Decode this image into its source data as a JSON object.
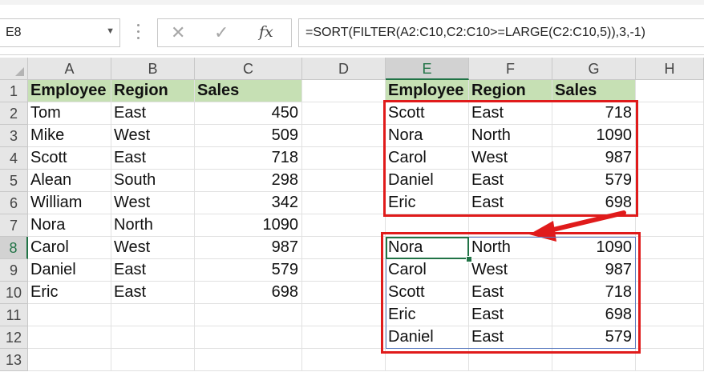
{
  "formula_bar": {
    "name_box": "E8",
    "cancel_icon": "✕",
    "enter_icon": "✓",
    "fx_label": "fx",
    "formula": "=SORT(FILTER(A2:C10,C2:C10>=LARGE(C2:C10,5)),3,-1)"
  },
  "columns": [
    "A",
    "B",
    "C",
    "D",
    "E",
    "F",
    "G",
    "H"
  ],
  "selected_column": "E",
  "rows": [
    "1",
    "2",
    "3",
    "4",
    "5",
    "6",
    "7",
    "8",
    "9",
    "10",
    "11",
    "12",
    "13"
  ],
  "selected_row": "8",
  "source_table": {
    "headers": [
      "Employee",
      "Region",
      "Sales"
    ],
    "rows": [
      [
        "Tom",
        "East",
        "450"
      ],
      [
        "Mike",
        "West",
        "509"
      ],
      [
        "Scott",
        "East",
        "718"
      ],
      [
        "Alean",
        "South",
        "298"
      ],
      [
        "William",
        "West",
        "342"
      ],
      [
        "Nora",
        "North",
        "1090"
      ],
      [
        "Carol",
        "West",
        "987"
      ],
      [
        "Daniel",
        "East",
        "579"
      ],
      [
        "Eric",
        "East",
        "698"
      ]
    ]
  },
  "filtered_table": {
    "headers": [
      "Employee",
      "Region",
      "Sales"
    ],
    "rows": [
      [
        "Scott",
        "East",
        "718"
      ],
      [
        "Nora",
        "North",
        "1090"
      ],
      [
        "Carol",
        "West",
        "987"
      ],
      [
        "Daniel",
        "East",
        "579"
      ],
      [
        "Eric",
        "East",
        "698"
      ]
    ]
  },
  "sorted_table": {
    "rows": [
      [
        "Nora",
        "North",
        "1090"
      ],
      [
        "Carol",
        "West",
        "987"
      ],
      [
        "Scott",
        "East",
        "718"
      ],
      [
        "Eric",
        "East",
        "698"
      ],
      [
        "Daniel",
        "East",
        "579"
      ]
    ]
  },
  "colors": {
    "header_fill": "#c6e0b4",
    "annotation_red": "#e01b1b",
    "active_green": "#217346",
    "spill_blue": "#5b7bc0"
  }
}
